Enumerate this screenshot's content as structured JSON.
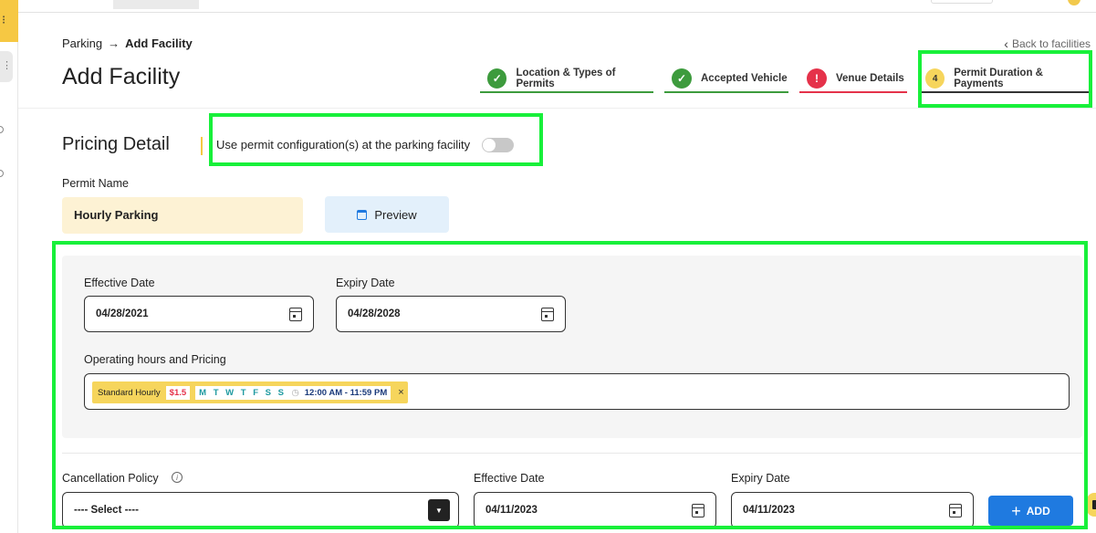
{
  "breadcrumb": {
    "parent": "Parking",
    "arrow": "→",
    "current": "Add Facility"
  },
  "back_link": "Back to facilities",
  "page_title": "Add Facility",
  "stepper": [
    {
      "label": "Location & Types of Permits",
      "status": "done",
      "icon": "check-icon",
      "color": "#3d9b3d"
    },
    {
      "label": "Accepted Vehicle",
      "status": "done",
      "icon": "check-icon",
      "color": "#3d9b3d"
    },
    {
      "label": "Venue Details",
      "status": "error",
      "icon": "alert-icon",
      "color": "#e5324a"
    },
    {
      "label": "Permit Duration & Payments",
      "status": "active",
      "number": "4",
      "color": "#f6d55c"
    }
  ],
  "pricing": {
    "title": "Pricing Detail",
    "toggle_label": "Use permit configuration(s) at the parking facility",
    "toggle_on": false
  },
  "permit": {
    "label": "Permit Name",
    "value": "Hourly Parking",
    "preview_label": "Preview"
  },
  "dates": {
    "effective_label": "Effective Date",
    "effective_value": "04/28/2021",
    "expiry_label": "Expiry Date",
    "expiry_value": "04/28/2028"
  },
  "hours": {
    "label": "Operating hours and Pricing",
    "chip": {
      "name": "Standard Hourly",
      "price": "$1.5",
      "days": "M T W T F S S",
      "clock": "◷",
      "time": "12:00 AM - 11:59 PM",
      "remove": "×"
    }
  },
  "cancellation": {
    "label": "Cancellation Policy",
    "info": "i",
    "select_value": "---- Select ----",
    "effective_label": "Effective Date",
    "effective_value": "04/11/2023",
    "expiry_label": "Expiry Date",
    "expiry_value": "04/11/2023",
    "add_label": "ADD"
  },
  "colors": {
    "highlight": "#18f03a",
    "accent_blue": "#1f7ae0",
    "accent_yellow": "#f6d55c"
  }
}
